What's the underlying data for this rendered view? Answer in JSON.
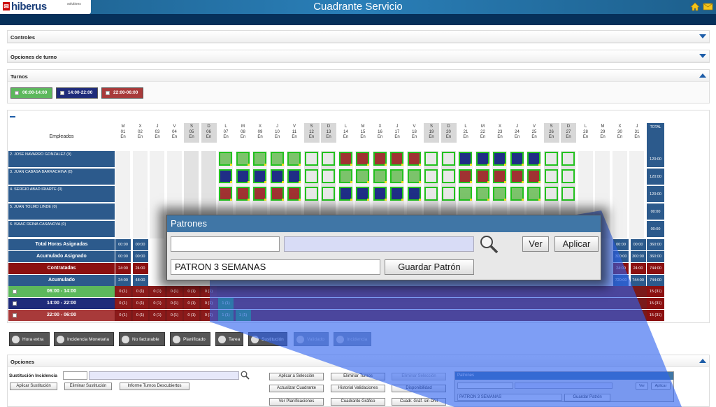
{
  "header": {
    "logo_text": "hiberus",
    "logo_sub": "solutions",
    "title": "Cuadrante Servicio"
  },
  "panels": {
    "controles": "Controles",
    "opciones_turno": "Opciones de turno",
    "turnos": "Turnos",
    "opciones": "Opciones"
  },
  "shifts": [
    {
      "label": "06:00-14:00",
      "color": "#5cb85c"
    },
    {
      "label": "14:00-22:00",
      "color": "#1f2b7a"
    },
    {
      "label": "22:00-06:00",
      "color": "#a83a3a"
    }
  ],
  "grid": {
    "empleados_header": "Empleados",
    "total_header": "TOTAL",
    "days": [
      {
        "d": "M",
        "n": "01",
        "m": "En"
      },
      {
        "d": "X",
        "n": "02",
        "m": "En"
      },
      {
        "d": "J",
        "n": "03",
        "m": "En"
      },
      {
        "d": "V",
        "n": "04",
        "m": "En"
      },
      {
        "d": "S",
        "n": "05",
        "m": "En"
      },
      {
        "d": "D",
        "n": "06",
        "m": "En"
      },
      {
        "d": "L",
        "n": "07",
        "m": "En"
      },
      {
        "d": "M",
        "n": "08",
        "m": "En"
      },
      {
        "d": "X",
        "n": "09",
        "m": "En"
      },
      {
        "d": "J",
        "n": "10",
        "m": "En"
      },
      {
        "d": "V",
        "n": "11",
        "m": "En"
      },
      {
        "d": "S",
        "n": "12",
        "m": "En"
      },
      {
        "d": "D",
        "n": "13",
        "m": "En"
      },
      {
        "d": "L",
        "n": "14",
        "m": "En"
      },
      {
        "d": "M",
        "n": "15",
        "m": "En"
      },
      {
        "d": "X",
        "n": "16",
        "m": "En"
      },
      {
        "d": "J",
        "n": "17",
        "m": "En"
      },
      {
        "d": "V",
        "n": "18",
        "m": "En"
      },
      {
        "d": "S",
        "n": "19",
        "m": "En"
      },
      {
        "d": "D",
        "n": "20",
        "m": "En"
      },
      {
        "d": "L",
        "n": "21",
        "m": "En"
      },
      {
        "d": "M",
        "n": "22",
        "m": "En"
      },
      {
        "d": "X",
        "n": "23",
        "m": "En"
      },
      {
        "d": "J",
        "n": "24",
        "m": "En"
      },
      {
        "d": "V",
        "n": "25",
        "m": "En"
      },
      {
        "d": "S",
        "n": "26",
        "m": "En"
      },
      {
        "d": "D",
        "n": "27",
        "m": "En"
      },
      {
        "d": "L",
        "n": "28",
        "m": "En"
      },
      {
        "d": "M",
        "n": "29",
        "m": "En"
      },
      {
        "d": "X",
        "n": "30",
        "m": "En"
      },
      {
        "d": "J",
        "n": "31",
        "m": "En"
      }
    ],
    "employees": [
      {
        "name": "2. JOSE NAVARRO GONZALEZ (0)",
        "total": "120:00",
        "pattern": "GGGGGWWRRRRRWWBBBBBWW"
      },
      {
        "name": "3. JUAN CABASA BARRACHINA (0)",
        "total": "120:00",
        "pattern": "BBBBBWWGGGGGWWRRRRRWW"
      },
      {
        "name": "4. SERGIO ABAD IRIARTE (0)",
        "total": "120:00",
        "pattern": "RRRRRWWBBBBBWWGGGGGWW"
      },
      {
        "name": "5. JUAN TOLMO LINDE (0)",
        "total": "00:00",
        "pattern": ""
      },
      {
        "name": "6. ISAAC REINA CASANOVA (0)",
        "total": "00:00",
        "pattern": ""
      }
    ],
    "summary": [
      {
        "label": "Total Horas Asignadas",
        "bg": "#2c5a8c",
        "vals": [
          "00:00",
          "00:00"
        ],
        "total": "360:00",
        "right": [
          "00:00",
          "00:00"
        ]
      },
      {
        "label": "Acumulado Asignado",
        "bg": "#2c5a8c",
        "vals": [
          "00:00",
          "00:00"
        ],
        "total": "360:00",
        "right": [
          "300:00",
          "300:00"
        ]
      },
      {
        "label": "Contratadas",
        "bg": "#8b1010",
        "vals": [
          "24:00",
          "24:00"
        ],
        "total": "744:00",
        "right": [
          "24:00",
          "24:00"
        ]
      },
      {
        "label": "Acumulado",
        "bg": "#2c5a8c",
        "vals": [
          "24:00",
          "48:00"
        ],
        "total": "744:00",
        "right": [
          "720:00",
          "744:00"
        ]
      }
    ],
    "shift_rows": [
      {
        "label": "06:00 - 14:00",
        "bg": "#5cb85c",
        "vals": [
          "0 (1)",
          "0 (1)",
          "0 (1)",
          "0 (1)",
          "0 (1)",
          "0 (1)"
        ],
        "total": "15 (31)"
      },
      {
        "label": "14:00 - 22:00",
        "bg": "#1f2b7a",
        "vals": [
          "0 (1)",
          "0 (1)",
          "0 (1)",
          "0 (1)",
          "0 (1)",
          "0 (1)",
          "1 (1)"
        ],
        "total": "15 (31)"
      },
      {
        "label": "22:00 - 06:00",
        "bg": "#a83a3a",
        "vals": [
          "0 (1)",
          "0 (1)",
          "0 (1)",
          "0 (1)",
          "0 (1)",
          "0 (1)",
          "1 (1)",
          "1 (1)"
        ],
        "total": "15 (31)"
      }
    ]
  },
  "actions": [
    {
      "label": "Hora extra",
      "disabled": false
    },
    {
      "label": "Incidencia Monetaria",
      "disabled": false
    },
    {
      "label": "No facturable",
      "disabled": false
    },
    {
      "label": "Planificado",
      "disabled": false
    },
    {
      "label": "Tarea",
      "disabled": false
    },
    {
      "label": "Sustitución",
      "disabled": false
    },
    {
      "label": "Validado",
      "disabled": true
    },
    {
      "label": "Incidencia",
      "disabled": true
    }
  ],
  "opciones": {
    "sustitucion_label": "Sustitución Incidencia",
    "btn_aplicar_sustitucion": "Aplicar Sustitución",
    "btn_eliminar_sustitucion": "Eliminar Sustitución",
    "btn_informe": "Informe Turnos Descubiertos",
    "btn_aplicar_seleccion": "Aplicar a Selección",
    "btn_eliminar_turnos": "Eliminar Turnos",
    "btn_eliminar_seleccion": "Eliminar Selección",
    "btn_actualizar": "Actualizar Cuadrante",
    "btn_historial": "Historial Validaciones",
    "btn_disponibilidad": "Disponibilidad",
    "btn_ver_planificaciones": "Ver Planificaciones",
    "btn_cuadrante_grafico": "Cuadrante Gráfico",
    "btn_cuadr_graf": "Cuadr. Gráf. sin DNI"
  },
  "patrones": {
    "title": "Patrones",
    "ver": "Ver",
    "aplicar": "Aplicar",
    "pattern_name": "PATRON 3 SEMANAS",
    "guardar": "Guardar Patrón"
  }
}
